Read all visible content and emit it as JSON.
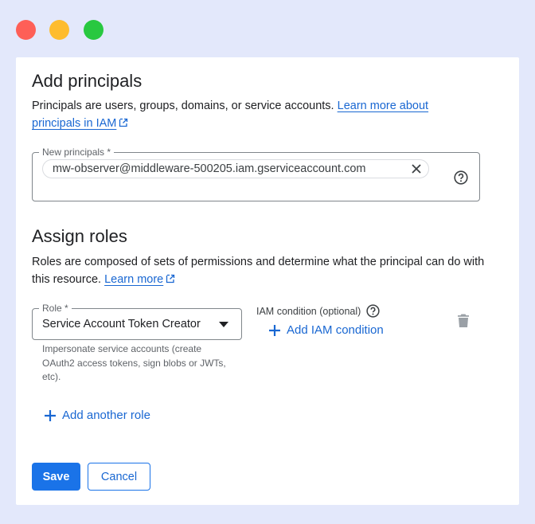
{
  "window": {
    "controls": [
      "close",
      "minimize",
      "maximize"
    ]
  },
  "principals_section": {
    "title": "Add principals",
    "description": "Principals are users, groups, domains, or service accounts.",
    "learn_more_label": "Learn more about principals in IAM",
    "field_label": "New principals *",
    "chip_value": "mw-observer@middleware-500205.iam.gserviceaccount.com",
    "help_icon": "help-circle-icon"
  },
  "roles_section": {
    "title": "Assign roles",
    "description": "Roles are composed of sets of permissions and determine what the principal can do with this resource.",
    "learn_more_label": "Learn more",
    "role_field_label": "Role *",
    "role_value": "Service Account Token Creator",
    "role_hint": "Impersonate service accounts (create OAuth2 access tokens, sign blobs or JWTs, etc).",
    "condition_label": "IAM condition (optional)",
    "add_condition_label": "Add IAM condition",
    "add_role_label": "Add another role"
  },
  "footer": {
    "save_label": "Save",
    "cancel_label": "Cancel"
  },
  "colors": {
    "accent": "#1a73e8",
    "link": "#1967d2",
    "background": "#e3e8fb"
  }
}
